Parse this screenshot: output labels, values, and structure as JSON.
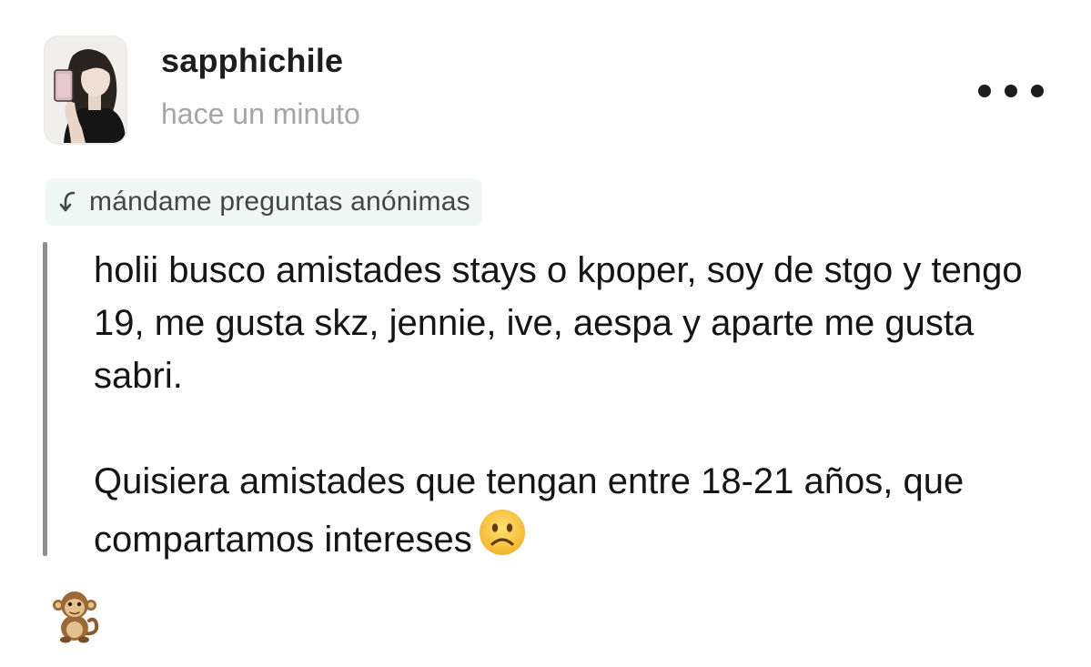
{
  "post": {
    "username": "sapphichile",
    "timestamp": "hace un minuto",
    "prompt_label": "mándame preguntas anónimas",
    "paragraphs": [
      "holii busco amistades stays o kpoper, soy de stgo y tengo 19, me gusta skz, jennie, ive, aespa y aparte me gusta sabri.",
      "Quisiera amistades que tengan entre 18-21 años, que compartamos intereses"
    ],
    "inline_emoji": "frowning-face",
    "footer_emoji": "sitting-monkey"
  },
  "icons": {
    "more": "more-horizontal-icon",
    "prompt": "reply-arrow-icon"
  },
  "colors": {
    "prompt_bg": "#f1f7f4",
    "timestamp": "#a3a6a4",
    "quote_bar": "#8e8e8e",
    "text": "#151515"
  }
}
